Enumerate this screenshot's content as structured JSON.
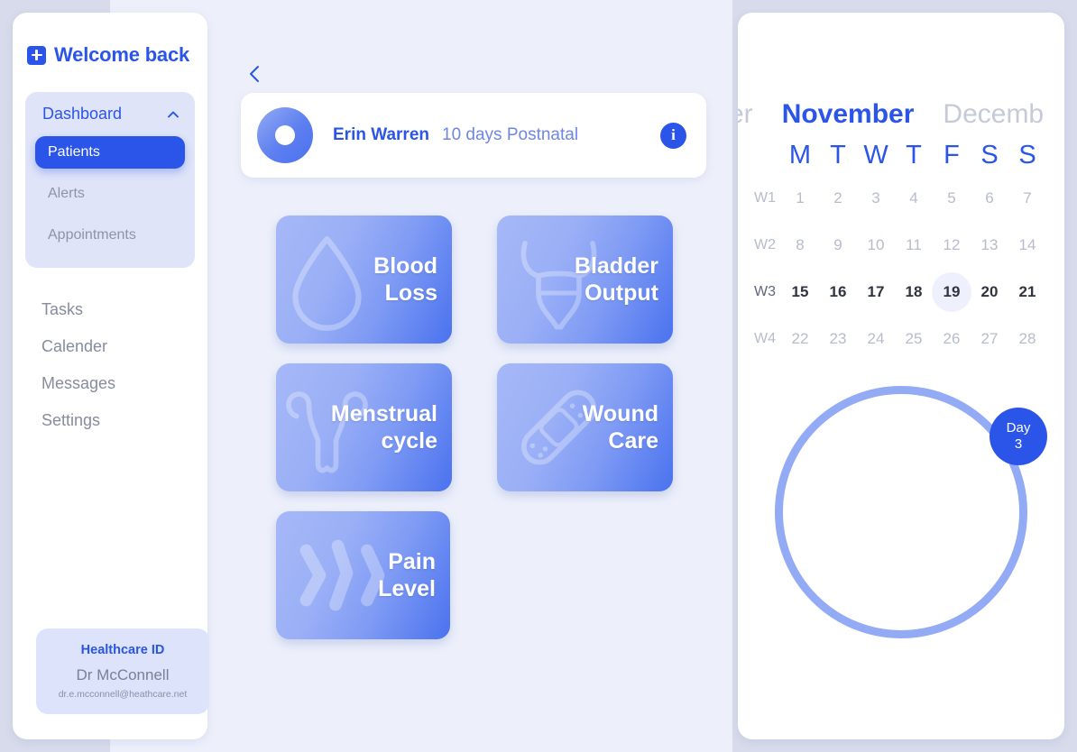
{
  "theme": {
    "accent": "#2b55e8",
    "accent_soft": "#93aaf5",
    "page_bg": "#d7dbeb",
    "panel_bg": "#edf0fb",
    "card_bg": "#ffffff",
    "muted_text": "#868c9e"
  },
  "sidebar": {
    "brand": {
      "icon": "plus-square-icon",
      "label": "Welcome back"
    },
    "group": {
      "title": "Dashboard",
      "chevron": "chevron-up-icon",
      "items": [
        {
          "label": "Patients",
          "active": true
        },
        {
          "label": "Alerts",
          "active": false
        },
        {
          "label": "Appointments",
          "active": false
        }
      ]
    },
    "nav": [
      {
        "label": "Tasks"
      },
      {
        "label": "Calender"
      },
      {
        "label": "Messages"
      },
      {
        "label": "Settings"
      }
    ],
    "id_card": {
      "title": "Healthcare ID",
      "name": "Dr McConnell",
      "email": "dr.e.mcconnell@heathcare.net"
    }
  },
  "main": {
    "back_icon": "chevron-left-icon",
    "patient": {
      "avatar": "patient-avatar-ring",
      "name": "Erin Warren",
      "status": "10 days Postnatal",
      "info_icon": "info-icon",
      "info_glyph": "i"
    },
    "tiles": [
      {
        "line1": "Blood",
        "line2": "Loss",
        "icon": "blood-drop-icon"
      },
      {
        "line1": "Bladder",
        "line2": "Output",
        "icon": "bladder-icon"
      },
      {
        "line1": "Menstrual",
        "line2": "cycle",
        "icon": "uterus-icon"
      },
      {
        "line1": "Wound",
        "line2": "Care",
        "icon": "bandage-icon"
      },
      {
        "line1": "Pain",
        "line2": "Level",
        "icon": "pain-bolt-icon"
      }
    ]
  },
  "calendar": {
    "months": [
      {
        "label": "er",
        "active": false
      },
      {
        "label": "November",
        "active": true
      },
      {
        "label": "Decemb",
        "active": false
      }
    ],
    "dow": [
      "M",
      "T",
      "W",
      "T",
      "F",
      "S",
      "S"
    ],
    "weeks": [
      {
        "label": "W1",
        "active": false,
        "days": [
          "1",
          "2",
          "3",
          "4",
          "5",
          "6",
          "7"
        ]
      },
      {
        "label": "W2",
        "active": false,
        "days": [
          "8",
          "9",
          "10",
          "11",
          "12",
          "13",
          "14"
        ]
      },
      {
        "label": "W3",
        "active": true,
        "days": [
          "15",
          "16",
          "17",
          "18",
          "19",
          "20",
          "21"
        ]
      },
      {
        "label": "W4",
        "active": false,
        "days": [
          "22",
          "23",
          "24",
          "25",
          "26",
          "27",
          "28"
        ]
      }
    ],
    "selected_day": "19",
    "progress_ring": {
      "badge_line1": "Day",
      "badge_line2": "3"
    }
  }
}
